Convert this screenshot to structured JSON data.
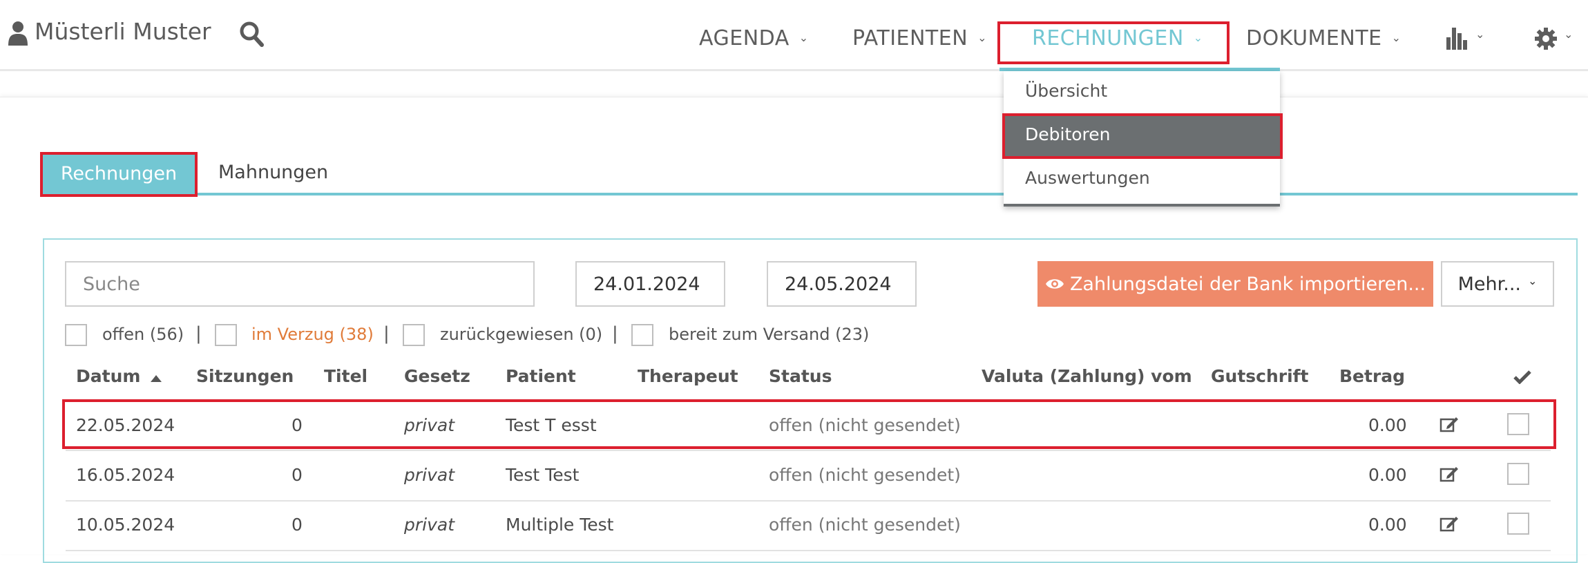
{
  "header": {
    "user_name": "Müsterli Muster",
    "nav": [
      {
        "label": "AGENDA"
      },
      {
        "label": "PATIENTEN"
      },
      {
        "label": "RECHNUNGEN"
      },
      {
        "label": "DOKUMENTE"
      }
    ],
    "chevron": "⌄",
    "accent_color": "#73c7d3"
  },
  "dropdown": {
    "items": [
      "Übersicht",
      "Debitoren",
      "Auswertungen"
    ],
    "highlighted": "Debitoren"
  },
  "tabs": [
    "Rechnungen",
    "Mahnungen"
  ],
  "filters": {
    "search_placeholder": "Suche",
    "date_from": "24.01.2024",
    "date_to": "24.05.2024",
    "import_button": "Zahlungsdatei der Bank importieren...",
    "more_button": "Mehr...",
    "status_filters": [
      {
        "label": "offen (56)"
      },
      {
        "label": "im Verzug (38)"
      },
      {
        "label": "zurückgewiesen (0)"
      },
      {
        "label": "bereit zum Versand (23)"
      }
    ],
    "separator": "|"
  },
  "table": {
    "headers": [
      "Datum",
      "Sitzungen",
      "Titel",
      "Gesetz",
      "Patient",
      "Therapeut",
      "Status",
      "Valuta (Zahlung) vom",
      "Gutschrift",
      "Betrag"
    ],
    "rows": [
      {
        "datum": "22.05.2024",
        "sitzungen": "0",
        "gesetz": "privat",
        "patient": "Test T esst",
        "status": "offen (nicht gesendet)",
        "betrag": "0.00"
      },
      {
        "datum": "16.05.2024",
        "sitzungen": "0",
        "gesetz": "privat",
        "patient": "Test Test",
        "status": "offen (nicht gesendet)",
        "betrag": "0.00"
      },
      {
        "datum": "10.05.2024",
        "sitzungen": "0",
        "gesetz": "privat",
        "patient": "Multiple Test",
        "status": "offen (nicht gesendet)",
        "betrag": "0.00"
      }
    ]
  }
}
